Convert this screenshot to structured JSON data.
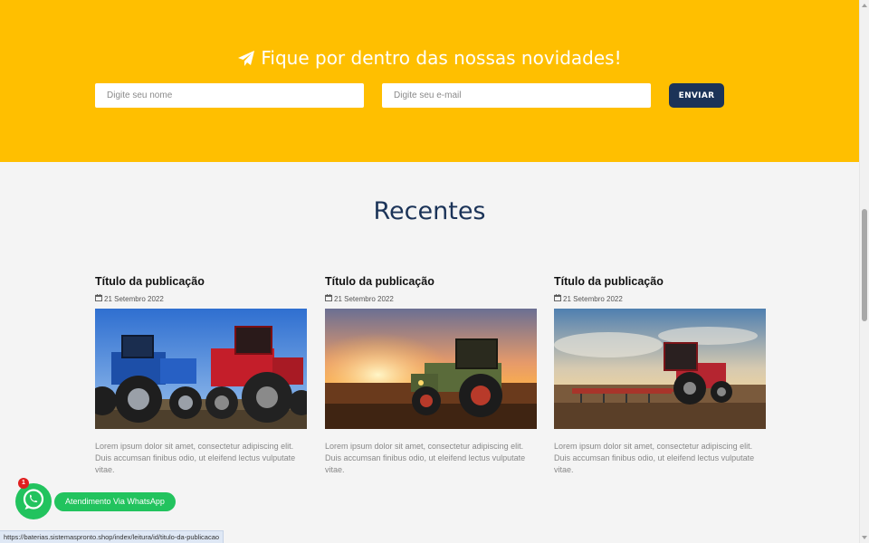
{
  "newsletter": {
    "title": "Fique por dentro das nossas novidades!",
    "name_placeholder": "Digite seu nome",
    "email_placeholder": "Digite seu e-mail",
    "submit_label": "ENVIAR",
    "background_color": "#ffbf00",
    "button_color": "#1b3358"
  },
  "recent": {
    "heading": "Recentes",
    "posts": [
      {
        "title": "Título da publicação",
        "date": "21 Setembro 2022",
        "excerpt": "Lorem ipsum dolor sit amet, consectetur adipiscing elit. Duis accumsan finibus odio, ut eleifend lectus vulputate vitae.",
        "image": "two-tractors-blue-red"
      },
      {
        "title": "Título da publicação",
        "date": "21 Setembro 2022",
        "excerpt": "Lorem ipsum dolor sit amet, consectetur adipiscing elit. Duis accumsan finibus odio, ut eleifend lectus vulputate vitae.",
        "image": "tractor-sunset"
      },
      {
        "title": "Título da publicação",
        "date": "21 Setembro 2022",
        "excerpt": "Lorem ipsum dolor sit amet, consectetur adipiscing elit. Duis accumsan finibus odio, ut eleifend lectus vulputate vitae.",
        "image": "tractor-plowing-field"
      }
    ]
  },
  "whatsapp": {
    "label": "Atendimento Via WhatsApp",
    "badge": "1",
    "color": "#22c35e"
  },
  "status_bar": {
    "url": "https://baterias.sistemaspronto.shop/index/leitura/id/titulo-da-publicacao"
  },
  "icons": {
    "title": "paper-plane-icon",
    "date": "calendar-icon",
    "chat": "whatsapp-icon"
  }
}
